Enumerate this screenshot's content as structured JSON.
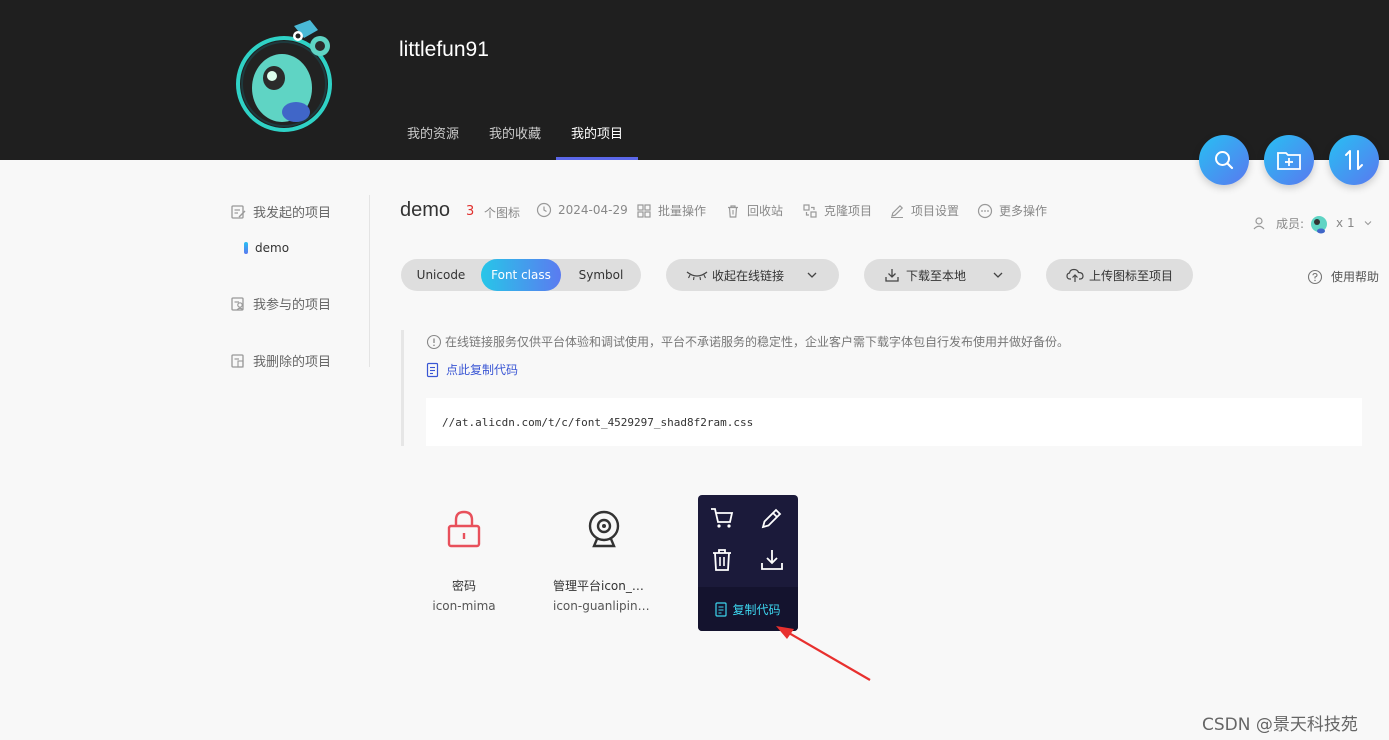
{
  "header": {
    "username": "littlefun91",
    "tabs": [
      {
        "label": "我的资源",
        "active": false
      },
      {
        "label": "我的收藏",
        "active": false
      },
      {
        "label": "我的项目",
        "active": true
      }
    ],
    "accent": "#5b67e8",
    "fabs": [
      "search-icon",
      "new-folder-icon",
      "sort-icon"
    ]
  },
  "sidebar": {
    "started_label": "我发起的项目",
    "current_project": "demo",
    "joined_label": "我参与的项目",
    "deleted_label": "我删除的项目"
  },
  "project": {
    "title": "demo",
    "icon_count": "3",
    "icon_count_label": "个图标",
    "date": "2024-04-29",
    "actions": {
      "batch": "批量操作",
      "recycle": "回收站",
      "clone": "克隆项目",
      "settings": "项目设置",
      "more": "更多操作"
    },
    "members_label": "成员:",
    "members_count": "x 1"
  },
  "toolbar": {
    "modes": [
      "Unicode",
      "Font class",
      "Symbol"
    ],
    "active_mode": "Font class",
    "collapse_link": "收起在线链接",
    "download": "下载至本地",
    "upload": "上传图标至项目",
    "help": "使用帮助"
  },
  "notice": {
    "text": "在线链接服务仅供平台体验和调试使用，平台不承诺服务的稳定性，企业客户需下载字体包自行发布使用并做好备份。",
    "copy_code": "点此复制代码",
    "css_url": "//at.alicdn.com/t/c/font_4529297_shad8f2ram.css"
  },
  "icons": [
    {
      "name": "密码",
      "code": "icon-mima",
      "glyph": "lock-icon",
      "color": "#e8505b"
    },
    {
      "name": "管理平台icon_安...",
      "code": "icon-guanlipingt...",
      "glyph": "webcam-icon",
      "color": "#333333"
    }
  ],
  "hover_card": {
    "actions": [
      "cart-icon",
      "edit-icon",
      "trash-icon",
      "download-icon"
    ],
    "copy_code": "复制代码"
  },
  "watermark": "CSDN @景天科技苑"
}
